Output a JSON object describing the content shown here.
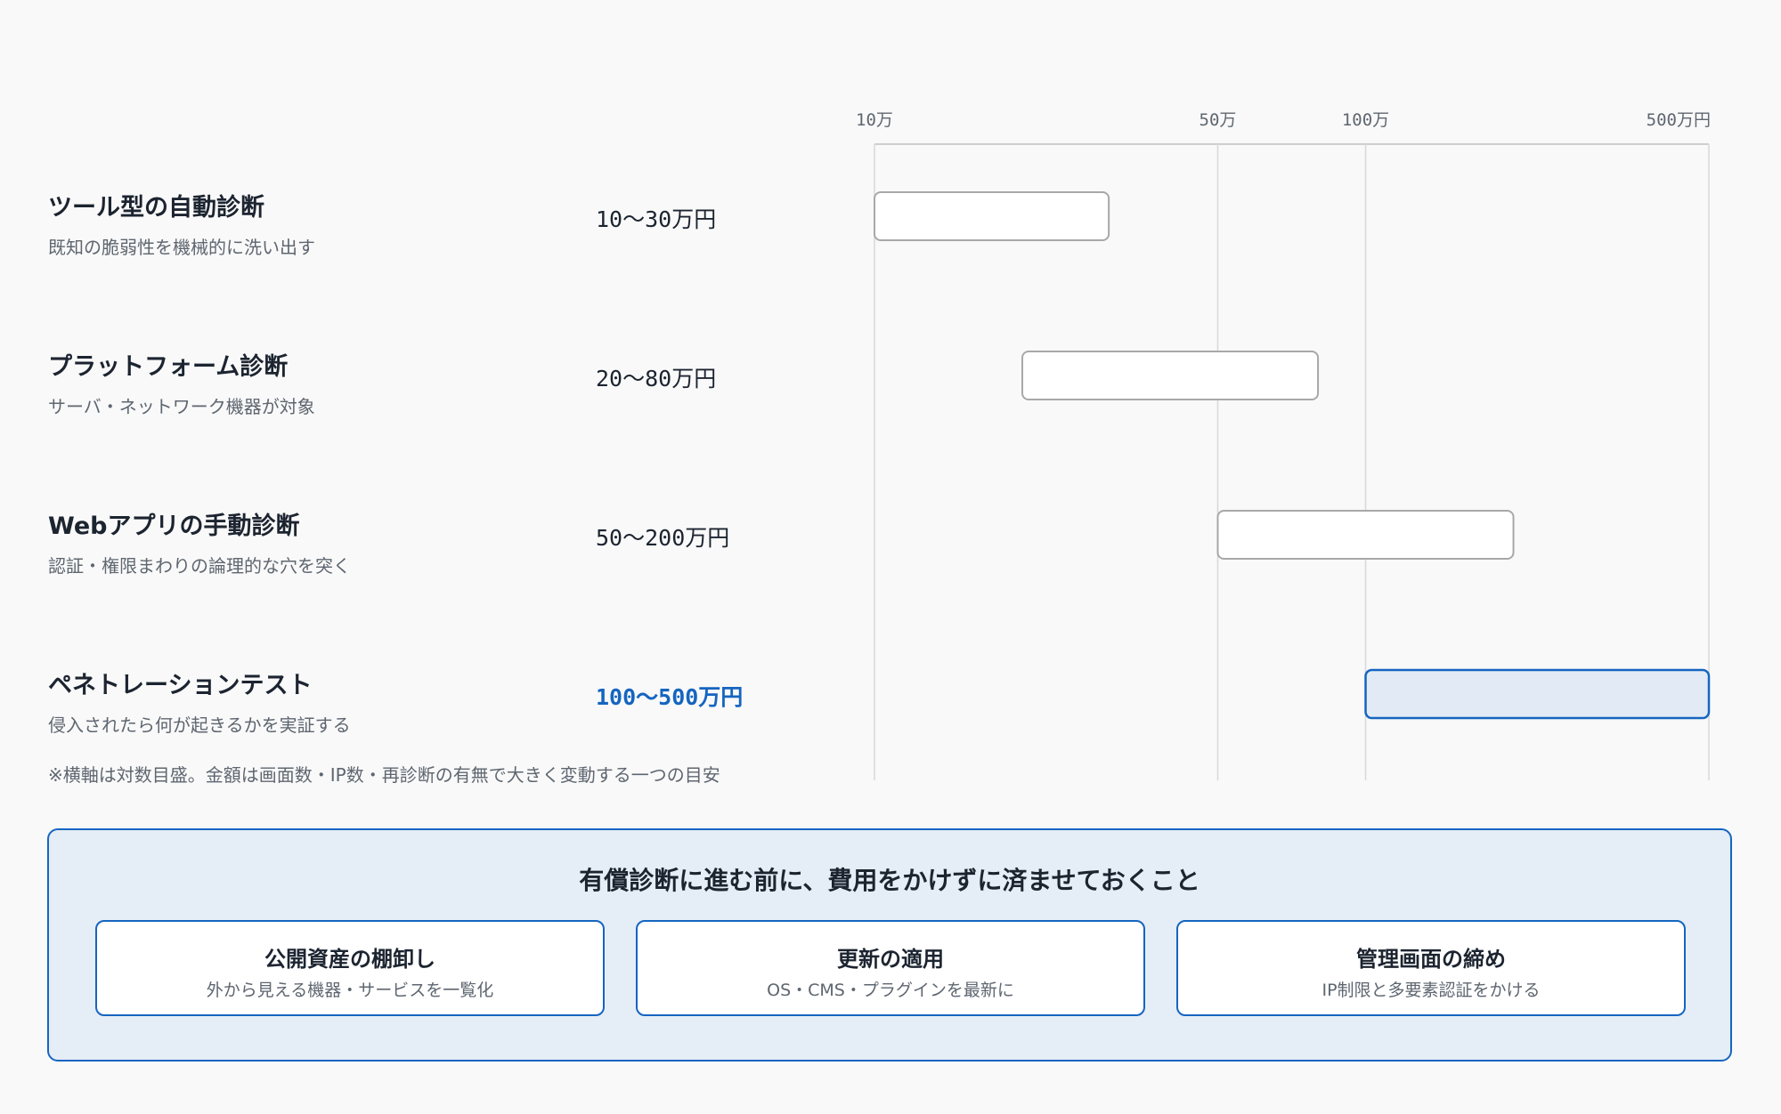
{
  "chart_data": {
    "type": "bar",
    "subtype": "range",
    "x_scale": "log",
    "xlim": [
      100000,
      5000000
    ],
    "grid": true,
    "ticks": [
      {
        "value": 100000,
        "label": "10万"
      },
      {
        "value": 500000,
        "label": "50万"
      },
      {
        "value": 1000000,
        "label": "100万"
      },
      {
        "value": 5000000,
        "label": "500万円"
      }
    ],
    "rows": [
      {
        "name": "ツール型の自動診断",
        "description": "既知の脆弱性を機械的に洗い出す",
        "price_label": "10〜30万円",
        "min": 100000,
        "max": 300000,
        "highlight": false
      },
      {
        "name": "プラットフォーム診断",
        "description": "サーバ・ネットワーク機器が対象",
        "price_label": "20〜80万円",
        "min": 200000,
        "max": 800000,
        "highlight": false
      },
      {
        "name": "Webアプリの手動診断",
        "description": "認証・権限まわりの論理的な穴を突く",
        "price_label": "50〜200万円",
        "min": 500000,
        "max": 2000000,
        "highlight": false
      },
      {
        "name": "ペネトレーションテスト",
        "description": "侵入されたら何が起きるかを実証する",
        "price_label": "100〜500万円",
        "min": 1000000,
        "max": 5000000,
        "highlight": true
      }
    ],
    "note": "※横軸は対数目盛。金額は画面数・IP数・再診断の有無で大きく変動する一つの目安"
  },
  "panel": {
    "title": "有償診断に進む前に、費用をかけずに済ませておくこと",
    "cards": [
      {
        "title": "公開資産の棚卸し",
        "sub": "外から見える機器・サービスを一覧化"
      },
      {
        "title": "更新の適用",
        "sub": "OS・CMS・プラグインを最新に"
      },
      {
        "title": "管理画面の締め",
        "sub": "IP制限と多要素認証をかける"
      }
    ]
  },
  "colors": {
    "text": "#1c2430",
    "muted": "#5e6670",
    "accent": "#1565c0",
    "accent_fill": "#e2ebf5",
    "bar_border": "#a8a8a8",
    "grid": "#d8d8d8",
    "panel_bg": "#e5edf6"
  }
}
